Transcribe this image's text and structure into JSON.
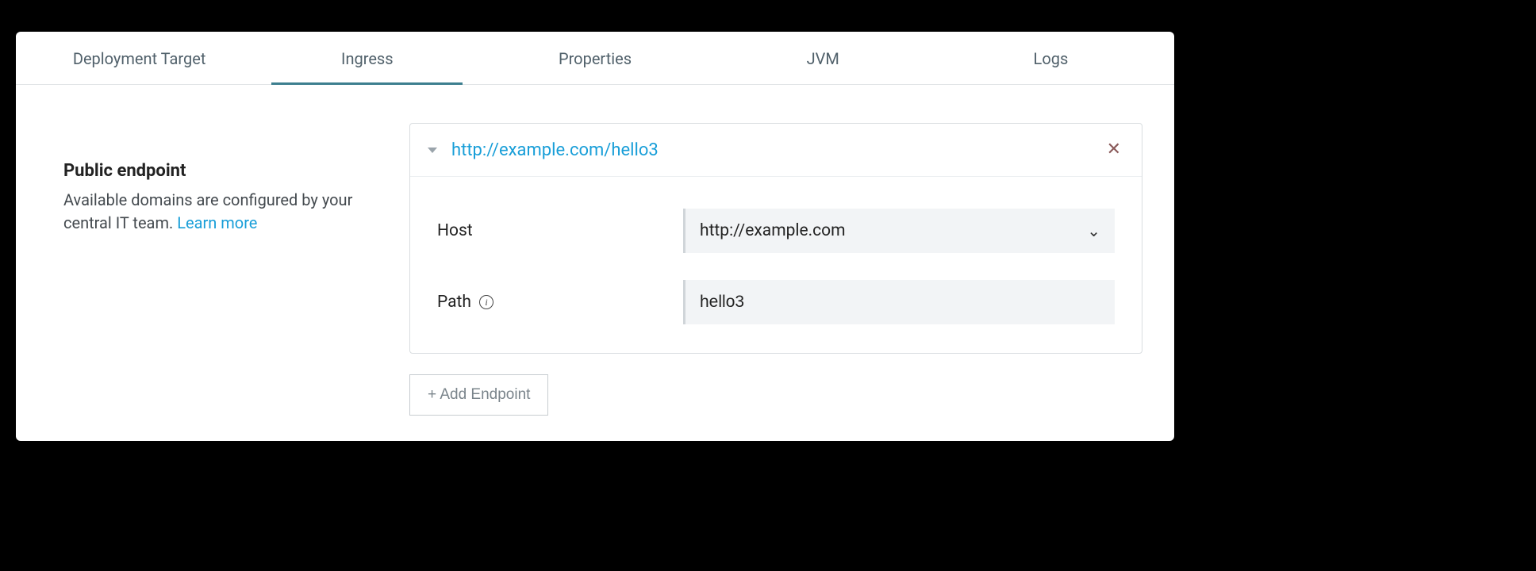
{
  "tabs": [
    {
      "label": "Deployment Target",
      "active": false
    },
    {
      "label": "Ingress",
      "active": true
    },
    {
      "label": "Properties",
      "active": false
    },
    {
      "label": "JVM",
      "active": false
    },
    {
      "label": "Logs",
      "active": false
    }
  ],
  "sidebar": {
    "heading": "Public endpoint",
    "description_prefix": "Available domains are configured by your central IT team. ",
    "learn_more": "Learn more"
  },
  "endpoint": {
    "url": "http://example.com/hello3",
    "fields": {
      "host_label": "Host",
      "host_value": "http://example.com",
      "path_label": "Path",
      "path_value": "hello3"
    }
  },
  "buttons": {
    "add_endpoint": "+ Add Endpoint"
  }
}
